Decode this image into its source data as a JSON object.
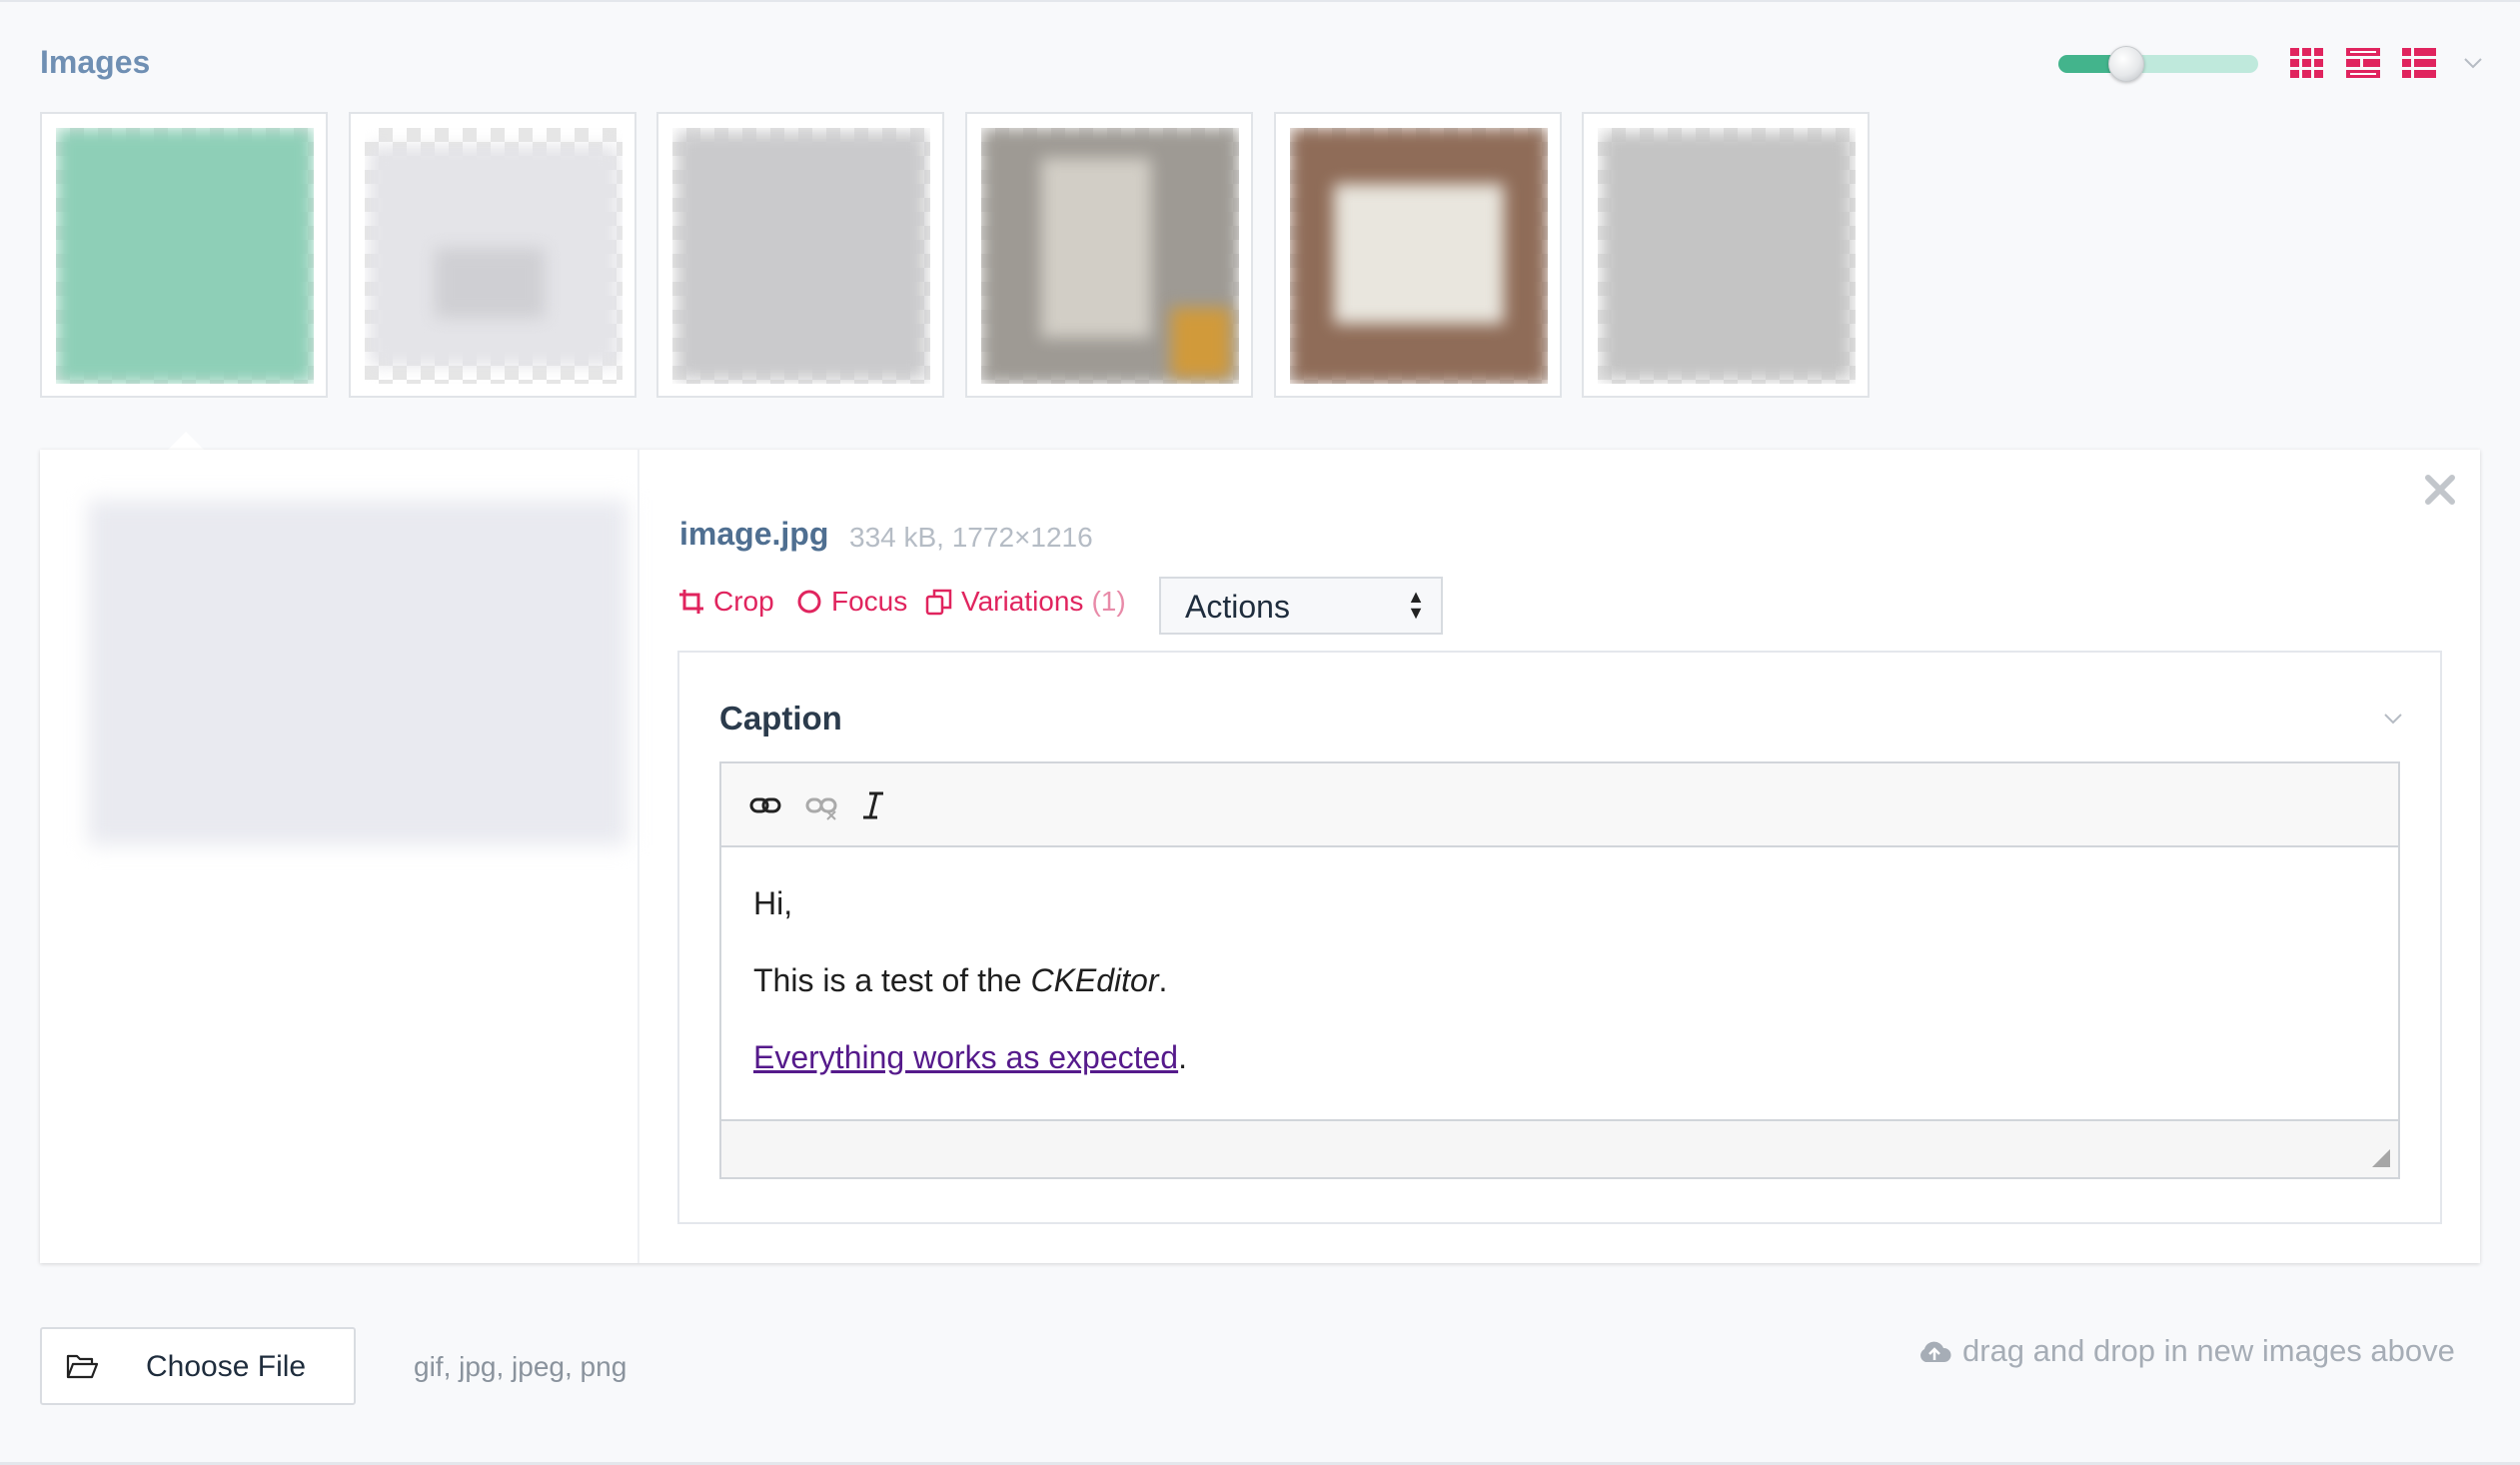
{
  "section": {
    "title": "Images"
  },
  "toolbar": {
    "size_slider": {
      "value_fraction": 0.33
    },
    "view_icons": [
      "grid-view-icon",
      "medium-list-view-icon",
      "list-view-icon"
    ],
    "dropdown_icon": "chevron-down-icon",
    "accent_color": "#e0245e",
    "slider_color": "#43b48c"
  },
  "thumbnails": [
    {
      "index": 1,
      "color": "#8ecfb7"
    },
    {
      "index": 2,
      "color": "#e7e7ea"
    },
    {
      "index": 3,
      "color": "#cdcdcf"
    },
    {
      "index": 4,
      "color": "#a7a39d"
    },
    {
      "index": 5,
      "color": "#8f6c58"
    },
    {
      "index": 6,
      "color": "#c6c6c6"
    }
  ],
  "detail": {
    "filename": "image.jpg",
    "fileinfo": "334 kB, 1772×1216",
    "actions": {
      "crop": "Crop",
      "focus": "Focus",
      "variations": "Variations",
      "variations_count": "(1)"
    },
    "select": {
      "value": "Actions"
    },
    "close_icon": "close-icon",
    "caption": {
      "title": "Caption",
      "toolbar": [
        "link-icon",
        "unlink-icon",
        "italic-icon"
      ],
      "content": {
        "line1": "Hi,",
        "line2_prefix": "This is a test of the ",
        "line2_em": "CKEditor",
        "line2_suffix": ".",
        "link_text": "Everything works as expected",
        "line3_suffix": "."
      }
    }
  },
  "upload": {
    "button_label": "Choose File",
    "formats": "gif, jpg, jpeg, png",
    "drop_hint": "drag and drop in new images above"
  }
}
